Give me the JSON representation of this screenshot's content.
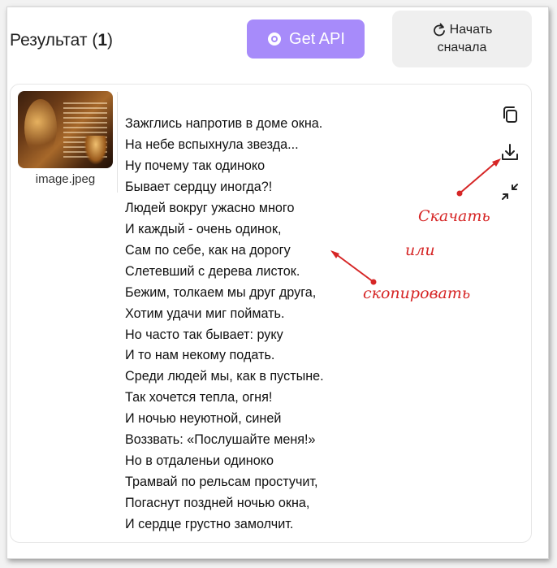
{
  "header": {
    "title_prefix": "Результат (",
    "count": "1",
    "title_suffix": ")",
    "get_api_label": "Get API",
    "restart_line1": "Начать",
    "restart_line2": "сначала"
  },
  "result": {
    "image_name": "image.jpeg",
    "poem_lines": [
      "Зажглись напротив в доме окна.",
      "На небе вспыхнула звезда...",
      "Ну почему так одиноко",
      "Бывает сердцу иногда?!",
      "Людей вокруг ужасно много",
      "И каждый - очень одинок,",
      "Сам по себе, как на дорогу",
      "Слетевший с дерева листок.",
      "Бежим, толкаем мы друг друга,",
      "Хотим удачи миг поймать.",
      "Но часто так бывает: руку",
      "И то нам некому подать.",
      "Среди людей мы, как в пустыне.",
      "Так хочется тепла, огня!",
      "И ночью неуютной, синей",
      "Воззвать: «Послушайте меня!»",
      "Но в отдаленьи одиноко",
      "Трамвай по рельсам простучит,",
      "Погаснут поздней ночью окна,",
      "И сердце грустно замолчит."
    ]
  },
  "annotations": {
    "download": "Скачать",
    "or": "или",
    "copy": "скопировать"
  },
  "icons": [
    "gear-icon",
    "refresh-icon",
    "copy-icon",
    "download-icon",
    "collapse-icon"
  ],
  "colors": {
    "accent": "#a78bfa",
    "annotation": "#d62626",
    "button_bg": "#efefef"
  }
}
